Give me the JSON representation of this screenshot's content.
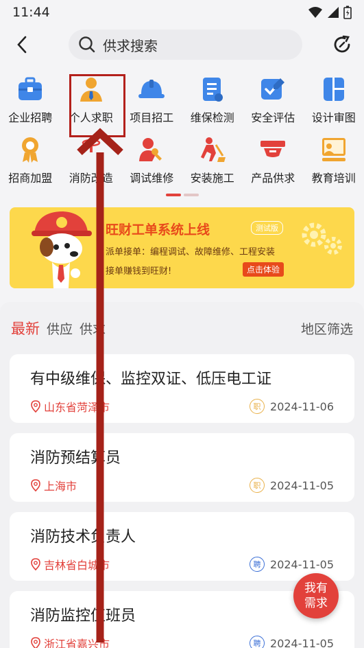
{
  "status_bar": {
    "time": "11:44"
  },
  "header": {
    "search_placeholder": "供求搜索"
  },
  "categories": [
    {
      "label": "企业招聘",
      "icon": "briefcase-icon",
      "color": "#3f86e8"
    },
    {
      "label": "个人求职",
      "icon": "person-tie-icon",
      "color": "#f0a530"
    },
    {
      "label": "项目招工",
      "icon": "hardhat-icon",
      "color": "#3f86e8"
    },
    {
      "label": "维保检测",
      "icon": "document-list-icon",
      "color": "#3f86e8"
    },
    {
      "label": "安全评估",
      "icon": "check-pen-icon",
      "color": "#3f86e8"
    },
    {
      "label": "设计审图",
      "icon": "layout-icon",
      "color": "#3f86e8"
    },
    {
      "label": "招商加盟",
      "icon": "medal-icon",
      "color": "#f0a530"
    },
    {
      "label": "消防改造",
      "icon": "sprinkler-icon",
      "color": "#e2413b"
    },
    {
      "label": "调试维修",
      "icon": "wrench-person-icon",
      "color": "#e2413b"
    },
    {
      "label": "安装施工",
      "icon": "digging-worker-icon",
      "color": "#e2413b"
    },
    {
      "label": "产品供求",
      "icon": "smoke-detector-icon",
      "color": "#e2413b"
    },
    {
      "label": "教育培训",
      "icon": "teaching-board-icon",
      "color": "#f0a530"
    }
  ],
  "banner": {
    "title": "旺财工单系统上线",
    "tag": "测试版",
    "line1": "派单接单：编程调试、故障维修、工程安装",
    "line2": "接单赚钱到旺财!",
    "cta": "点击体验"
  },
  "feed": {
    "tabs": [
      "最新",
      "供应",
      "供求"
    ],
    "active_tab": "最新",
    "filter_label": "地区筛选",
    "items": [
      {
        "title": "有中级维保、监控双证、低压电工证",
        "location": "山东省菏泽市",
        "tag": "职",
        "tag_type": "zhi",
        "date": "2024-11-06"
      },
      {
        "title": "消防预结算员",
        "location": "上海市",
        "tag": "职",
        "tag_type": "zhi",
        "date": "2024-11-05"
      },
      {
        "title": "消防技术负责人",
        "location": "吉林省白城市",
        "tag": "聘",
        "tag_type": "pin",
        "date": "2024-11-05"
      },
      {
        "title": "消防监控值班员",
        "location": "浙江省嘉兴市",
        "tag": "聘",
        "tag_type": "pin",
        "date": "2024-11-05"
      }
    ]
  },
  "fab": {
    "line1": "我有",
    "line2": "需求"
  },
  "colors": {
    "accent": "#e2413b",
    "banner_bg": "#fdd84c",
    "highlight": "#b3201b"
  }
}
